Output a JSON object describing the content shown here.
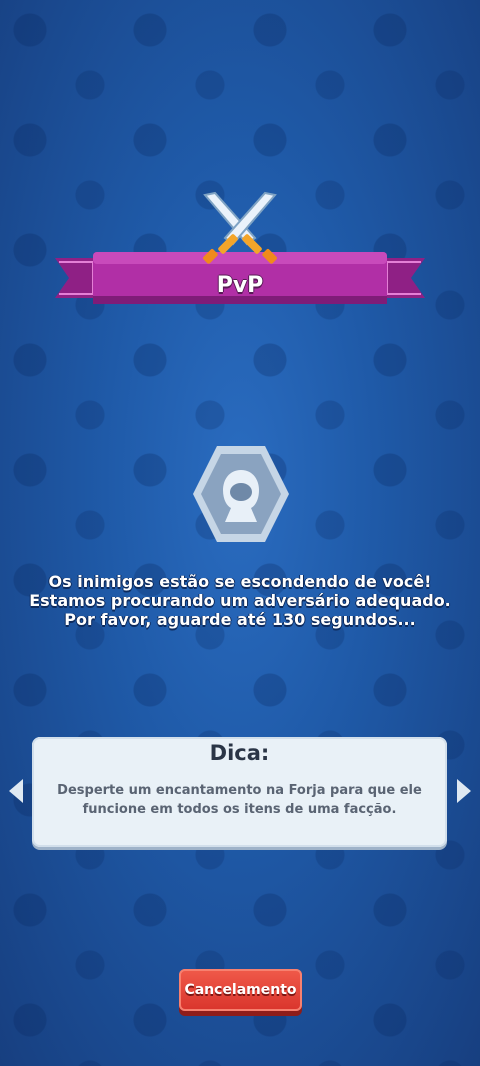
{
  "header": {
    "title": "PvP"
  },
  "search": {
    "message_lines": [
      "Os inimigos estão se escondendo de você!",
      "Estamos procurando um adversário adequado.",
      "Por favor, aguarde até 130 segundos..."
    ]
  },
  "tip": {
    "title": "Dica:",
    "body_lines": [
      "Desperte um encantamento na Forja para que ele",
      "funcione em todos os itens de uma facção."
    ]
  },
  "buttons": {
    "cancel_label": "Cancelamento"
  },
  "icons": {
    "title_icon": "crossed-swords-icon",
    "status_icon": "hooded-figure-icon",
    "prev": "arrow-left-icon",
    "next": "arrow-right-icon"
  },
  "colors": {
    "background": "#1f5aa8",
    "banner": "#b12fa6",
    "cancel_button": "#e2463a"
  }
}
